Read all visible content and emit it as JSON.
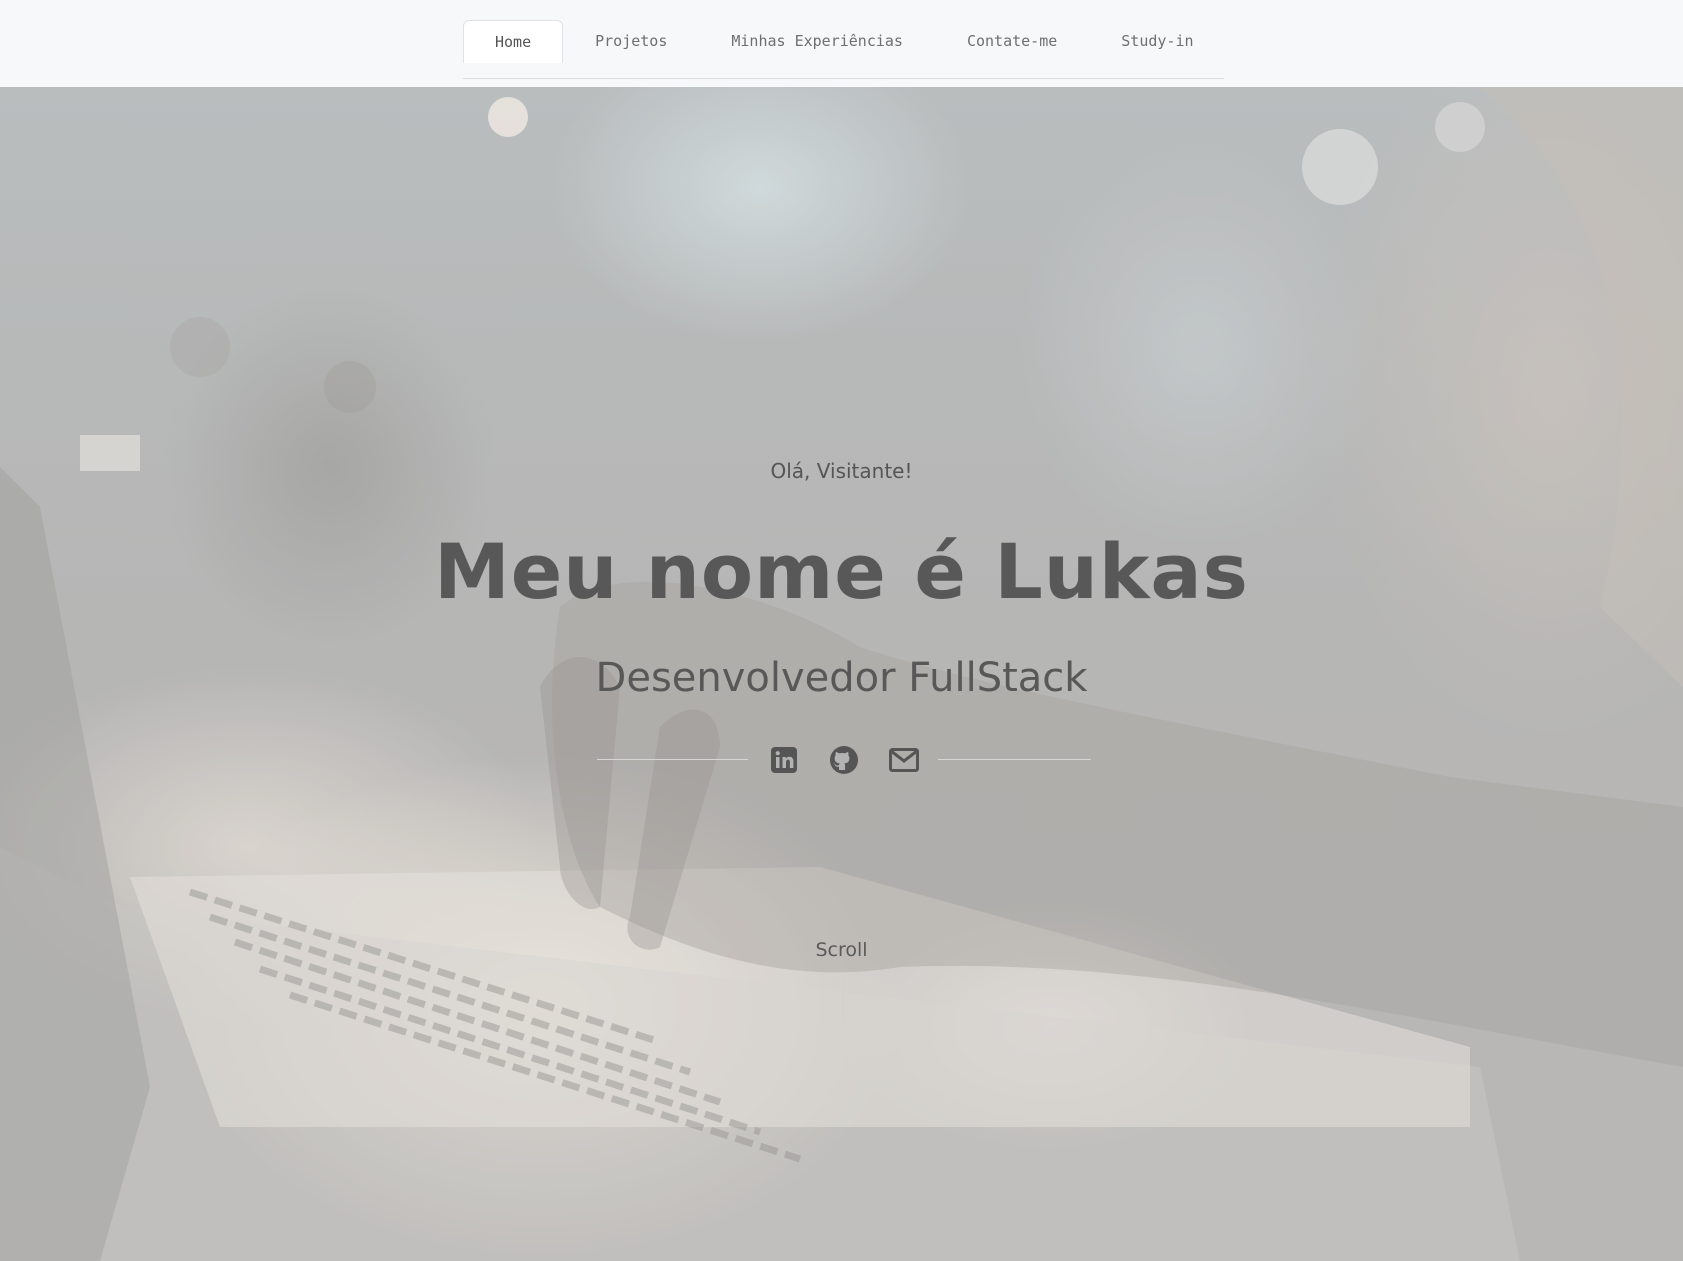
{
  "nav": {
    "tabs": [
      {
        "label": "Home",
        "active": true
      },
      {
        "label": "Projetos",
        "active": false
      },
      {
        "label": "Minhas Experiências",
        "active": false
      },
      {
        "label": "Contate-me",
        "active": false
      },
      {
        "label": "Study-in",
        "active": false
      }
    ]
  },
  "hero": {
    "greeting": "Olá, Visitante!",
    "name": "Meu nome é Lukas",
    "role": "Desenvolvedor FullStack",
    "scroll_label": "Scroll"
  },
  "social": {
    "icons": [
      "linkedin-icon",
      "github-icon",
      "mail-icon"
    ],
    "icon_color": "#555555"
  },
  "colors": {
    "navbar_bg": "#f7f8fa",
    "text": "#585858"
  }
}
